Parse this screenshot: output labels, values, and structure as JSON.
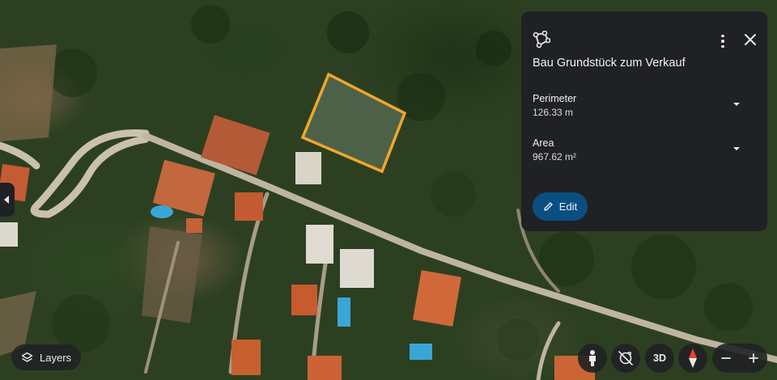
{
  "map": {
    "type": "satellite",
    "colors": {
      "selection_outline": "#f2a62a",
      "road": "#c9c0ae",
      "roof": "#c95f38",
      "pool": "#3aa6d8"
    }
  },
  "panel": {
    "icon": "polygon-measure-icon",
    "title": "Bau Grundstück zum Verkauf",
    "perimeter_label": "Perimeter",
    "perimeter_value": "126.33 m",
    "area_label": "Area",
    "area_value": "967.62 m²",
    "edit_label": "Edit",
    "colors": {
      "background": "#202124",
      "edit_button": "#0b4f82"
    }
  },
  "controls": {
    "layers_label": "Layers",
    "threed_label": "3D",
    "zoom_out_label": "−",
    "zoom_in_label": "+"
  }
}
